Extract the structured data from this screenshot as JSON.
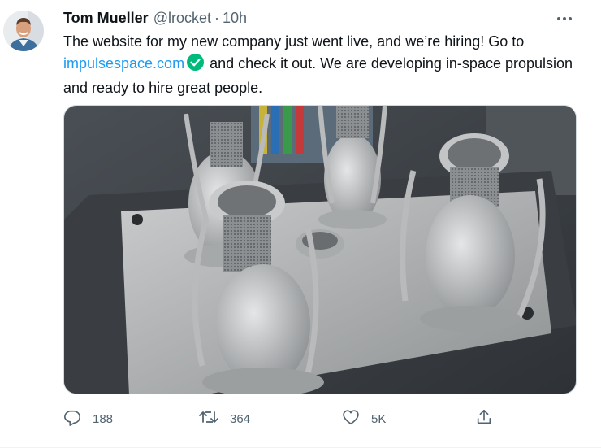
{
  "tweet": {
    "author_name": "Tom Mueller",
    "author_handle": "@lrocket",
    "separator": "·",
    "time": "10h",
    "text_part1": "The website for my new company just went live, and we’re hiring!  Go to",
    "link": "impulsespace.com",
    "text_part2": "and check it out.  We are developing in-space propulsion and ready to hire great people.",
    "media_description_icon": "photo-3d-printed-rocket-engines"
  },
  "actions": {
    "reply_count": "188",
    "retweet_count": "364",
    "like_count": "5K"
  },
  "colors": {
    "link": "#1d9bf0",
    "verified_badge": "#00ba7c",
    "muted": "#536471"
  }
}
